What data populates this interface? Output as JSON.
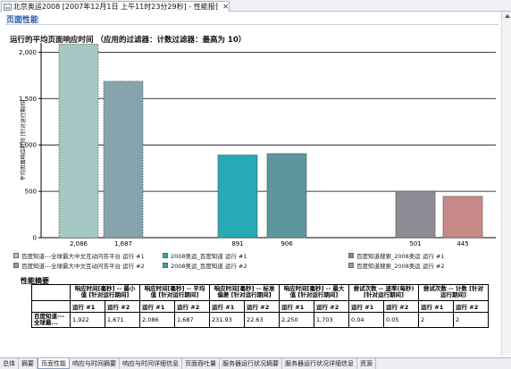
{
  "window": {
    "tab_title": "北京奥运2008 [2007年12月1日 上午11时23分29秒] - 性能报告",
    "close_symbol": "✕"
  },
  "page": {
    "title": "页面性能",
    "summary_title": "性能摘要"
  },
  "chart_data": {
    "type": "bar",
    "title": "运行的平均页面响应时间 （应用的过滤器：计数过滤器：最高为 10）",
    "ylabel": "平均页面响应时间 [针对运行期间]",
    "ylim": [
      0,
      2100
    ],
    "yticks": [
      0,
      500,
      1000,
      1500,
      2000
    ],
    "ytick_labels": [
      "0",
      "500",
      "1,000",
      "1,500",
      "2,000"
    ],
    "grid": "horizontal",
    "legend_position": "bottom",
    "categories": [
      "百度知道---全球最大中文互动问答平台 运行 #1",
      "百度知道---全球最大中文互动问答平台 运行 #2",
      "2008奥运_百度知道 运行 #1",
      "2008奥运_百度知道 运行 #2",
      "百度知道搜索_2008奥运 运行 #1",
      "百度知道搜索_2008奥运 运行 #2"
    ],
    "values": [
      2086,
      1687,
      891,
      906,
      501,
      445
    ],
    "value_labels": [
      "2,086",
      "1,687",
      "891",
      "906",
      "501",
      "445"
    ],
    "colors": [
      "#a6c8c5",
      "#86a4ad",
      "#27a9b6",
      "#5e969e",
      "#8e8b94",
      "#c88a88"
    ],
    "dashed_border": [
      true,
      true,
      false,
      false,
      false,
      false
    ]
  },
  "legend": [
    "百度知道---全球最大中文互动问答平台 运行 #1",
    "百度知道---全球最大中文互动问答平台 运行 #2",
    "2008奥运_百度知道 运行 #1",
    "2008奥运_百度知道 运行 #2",
    "百度知道搜索_2008奥运 运行 #1",
    "百度知道搜索_2008奥运 运行 #2"
  ],
  "summary_table": {
    "headers": [
      "响应时间[毫秒] -- 最小值 [针对运行期间]",
      "响应时间[毫秒] -- 平均值 [针对运行期间]",
      "响应时间[毫秒] -- 标准偏差 [针对运行期间]",
      "响应时间[毫秒] -- 最大值 [针对运行期间]",
      "尝试次数 -- 速率(每秒) [针对运行期间]",
      "尝试次数 -- 计数 [针对运行期间]"
    ],
    "run1": "运行 #1",
    "run2": "运行 #2",
    "row_label": "百度知道---全球最...",
    "row_values": [
      "1,922",
      "1,671",
      "2,086",
      "1,687",
      "231.93",
      "22.63",
      "2,250",
      "1,703",
      "0.04",
      "0.05",
      "2",
      "2"
    ]
  },
  "bottom_tabs": [
    "总体",
    "摘要",
    "页面性能",
    "响应与时间摘要",
    "响应与时间详细信息",
    "页面吞吐量",
    "服务器运行状况摘要",
    "服务器运行状况详细信息",
    "资源"
  ],
  "active_tab": "页面性能"
}
